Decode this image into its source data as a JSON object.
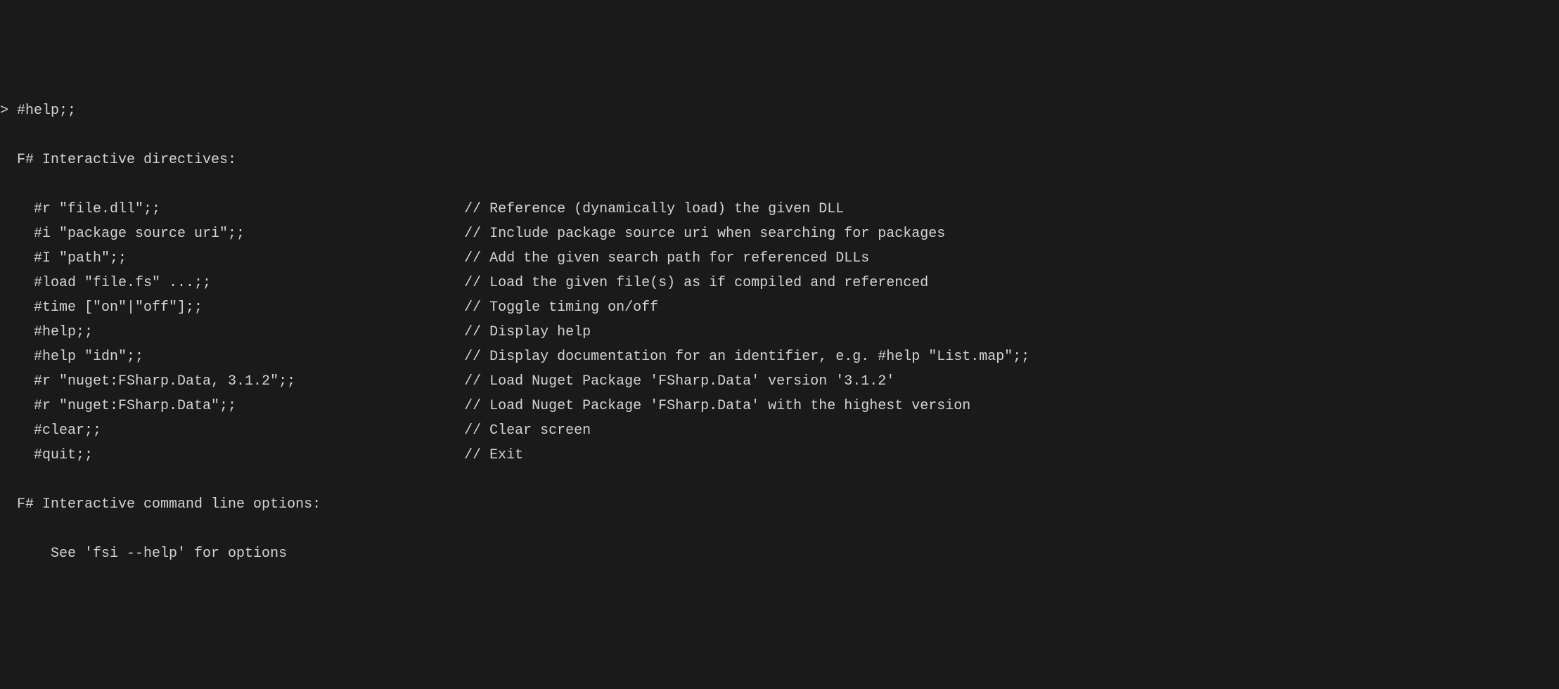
{
  "prompt": "> #help;;",
  "header_directives": "  F# Interactive directives:",
  "directives": [
    {
      "cmd": "    #r \"file.dll\";;                                    ",
      "comment": "// Reference (dynamically load) the given DLL"
    },
    {
      "cmd": "    #i \"package source uri\";;                          ",
      "comment": "// Include package source uri when searching for packages"
    },
    {
      "cmd": "    #I \"path\";;                                        ",
      "comment": "// Add the given search path for referenced DLLs"
    },
    {
      "cmd": "    #load \"file.fs\" ...;;                              ",
      "comment": "// Load the given file(s) as if compiled and referenced"
    },
    {
      "cmd": "    #time [\"on\"|\"off\"];;                               ",
      "comment": "// Toggle timing on/off"
    },
    {
      "cmd": "    #help;;                                            ",
      "comment": "// Display help"
    },
    {
      "cmd": "    #help \"idn\";;                                      ",
      "comment": "// Display documentation for an identifier, e.g. #help \"List.map\";;"
    },
    {
      "cmd": "    #r \"nuget:FSharp.Data, 3.1.2\";;                    ",
      "comment": "// Load Nuget Package 'FSharp.Data' version '3.1.2'"
    },
    {
      "cmd": "    #r \"nuget:FSharp.Data\";;                           ",
      "comment": "// Load Nuget Package 'FSharp.Data' with the highest version"
    },
    {
      "cmd": "    #clear;;                                           ",
      "comment": "// Clear screen"
    },
    {
      "cmd": "    #quit;;                                            ",
      "comment": "// Exit"
    }
  ],
  "header_options": "  F# Interactive command line options:",
  "options_note": "      See 'fsi --help' for options"
}
